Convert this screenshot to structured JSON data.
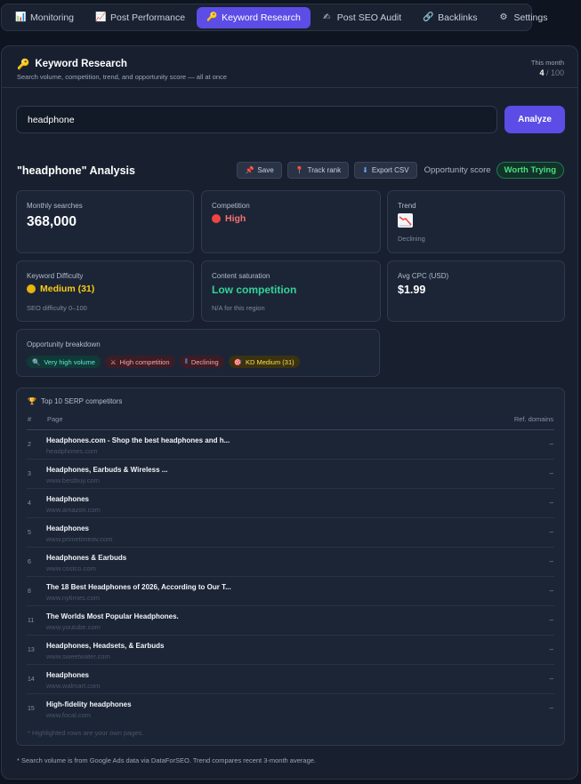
{
  "tabs": [
    {
      "label": "Monitoring",
      "icon": "chart-icon",
      "glyph": "📊",
      "active": false
    },
    {
      "label": "Post Performance",
      "icon": "trend-icon",
      "glyph": "📈",
      "active": false
    },
    {
      "label": "Keyword Research",
      "icon": "key-icon",
      "glyph": "🔑",
      "active": true
    },
    {
      "label": "Post SEO Audit",
      "icon": "writing-hand-icon",
      "glyph": "✍",
      "active": false
    },
    {
      "label": "Backlinks",
      "icon": "link-icon",
      "glyph": "🔗",
      "active": false
    },
    {
      "label": "Settings",
      "icon": "gear-icon",
      "glyph": "⚙",
      "active": false
    }
  ],
  "header": {
    "title": "Keyword Research",
    "subtitle": "Search volume, competition, trend, and opportunity score — all at once",
    "quota_label": "This month",
    "quota_used": "4",
    "quota_total": "/ 100"
  },
  "search": {
    "value": "headphone",
    "button": "Analyze"
  },
  "analysis": {
    "title": "\"headphone\" Analysis",
    "save": "Save",
    "track": "Track rank",
    "export": "Export CSV",
    "opportunity_label": "Opportunity score",
    "opportunity_value": "Worth Trying"
  },
  "metrics": {
    "monthly_label": "Monthly searches",
    "monthly_value": "368,000",
    "competition_label": "Competition",
    "competition_value": "High",
    "trend_label": "Trend",
    "trend_value": "Declining",
    "kd_label": "Keyword Difficulty",
    "kd_value": "Medium (31)",
    "kd_sub": "SEO difficulty 0–100",
    "saturation_label": "Content saturation",
    "saturation_value": "Low competition",
    "saturation_sub": "N/A for this region",
    "cpc_label": "Avg CPC (USD)",
    "cpc_value": "$1.99"
  },
  "breakdown": {
    "label": "Opportunity breakdown",
    "chips": [
      {
        "text": "Very high volume",
        "glyph": "🔍"
      },
      {
        "text": "High competition",
        "glyph": "⚔"
      },
      {
        "text": "Declining",
        "glyph": "⦀"
      },
      {
        "text": "KD Medium (31)",
        "glyph": "🎯"
      }
    ]
  },
  "serp": {
    "title": "Top 10 SERP competitors",
    "col_num": "#",
    "col_page": "Page",
    "col_domains": "Ref. domains",
    "rows": [
      {
        "rank": "2",
        "title": "Headphones.com - Shop the best headphones and h...",
        "url": "headphones.com",
        "domains": "–"
      },
      {
        "rank": "3",
        "title": "Headphones, Earbuds & Wireless ...",
        "url": "www.bestbuy.com",
        "domains": "–"
      },
      {
        "rank": "4",
        "title": "Headphones",
        "url": "www.amazon.com",
        "domains": "–"
      },
      {
        "rank": "5",
        "title": "Headphones",
        "url": "www.primetimeav.com",
        "domains": "–"
      },
      {
        "rank": "6",
        "title": "Headphones & Earbuds",
        "url": "www.costco.com",
        "domains": "–"
      },
      {
        "rank": "8",
        "title": "The 18 Best Headphones of 2026, According to Our T...",
        "url": "www.nytimes.com",
        "domains": "–"
      },
      {
        "rank": "11",
        "title": "The Worlds Most Popular Headphones.",
        "url": "www.youtube.com",
        "domains": "–"
      },
      {
        "rank": "13",
        "title": "Headphones, Headsets, & Earbuds",
        "url": "www.sweetwater.com",
        "domains": "–"
      },
      {
        "rank": "14",
        "title": "Headphones",
        "url": "www.walmart.com",
        "domains": "–"
      },
      {
        "rank": "15",
        "title": "High-fidelity headphones",
        "url": "www.focal.com",
        "domains": "–"
      }
    ],
    "note": "* Highlighted rows are your own pages."
  },
  "footnote": "* Search volume is from Google Ads data via DataForSEO. Trend compares recent 3-month average.",
  "colors": {
    "accent": "#5b4de6",
    "high": "#f87171",
    "medium": "#facc15",
    "low": "#4ade80"
  }
}
